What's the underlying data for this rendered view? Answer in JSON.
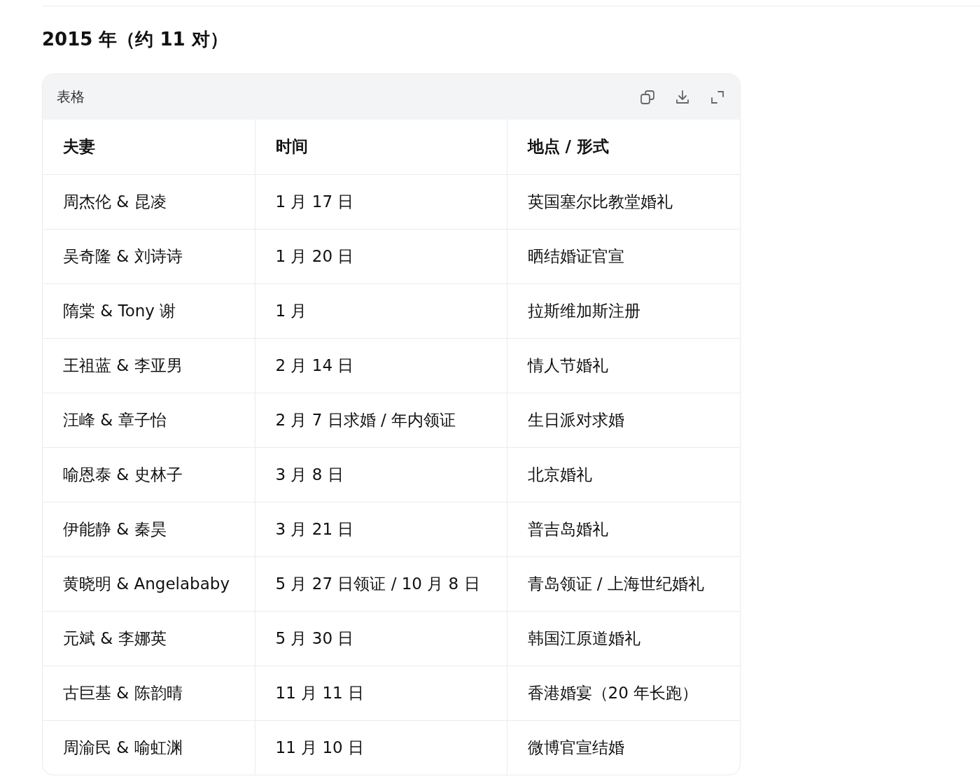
{
  "heading": "2015 年（约 11 对）",
  "table_card": {
    "title": "表格",
    "columns": [
      "夫妻",
      "时间",
      "地点 / 形式"
    ],
    "rows": [
      [
        "周杰伦 & 昆凌",
        "1 月 17 日",
        "英国塞尔比教堂婚礼"
      ],
      [
        "吴奇隆 & 刘诗诗",
        "1 月 20 日",
        "晒结婚证官宣"
      ],
      [
        "隋棠 & Tony 谢",
        "1 月",
        "拉斯维加斯注册"
      ],
      [
        "王祖蓝 & 李亚男",
        "2 月 14 日",
        "情人节婚礼"
      ],
      [
        "汪峰 & 章子怡",
        "2 月 7 日求婚 / 年内领证",
        "生日派对求婚"
      ],
      [
        "喻恩泰 & 史林子",
        "3 月 8 日",
        "北京婚礼"
      ],
      [
        "伊能静 & 秦昊",
        "3 月 21 日",
        "普吉岛婚礼"
      ],
      [
        "黄晓明 & Angelababy",
        "5 月 27 日领证 / 10 月 8 日",
        "青岛领证 / 上海世纪婚礼"
      ],
      [
        "元斌 & 李娜英",
        "5 月 30 日",
        "韩国江原道婚礼"
      ],
      [
        "古巨基 & 陈韵晴",
        "11 月 11 日",
        "香港婚宴（20 年长跑）"
      ],
      [
        "周渝民 & 喻虹渊",
        "11 月 10 日",
        "微博官宣结婚"
      ]
    ]
  }
}
